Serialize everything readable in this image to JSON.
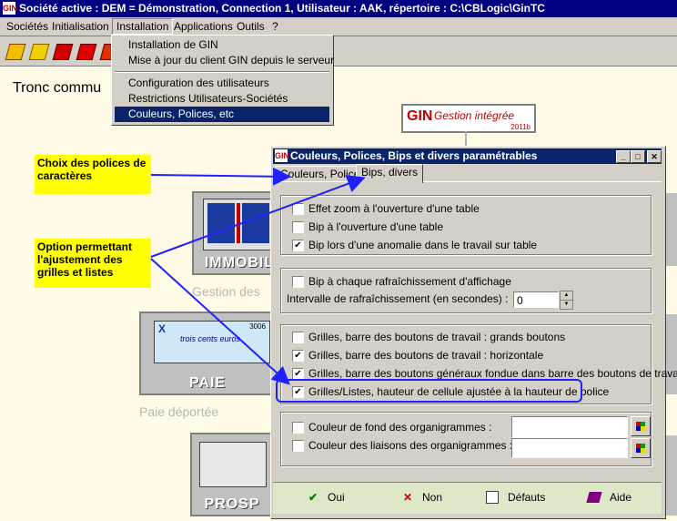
{
  "window": {
    "logo_text": "GIN",
    "title": "Société active : DEM = Démonstration, Connection 1, Utilisateur : AAK, répertoire : C:\\CBLogic\\GinTC"
  },
  "menu": {
    "items": [
      "Sociétés",
      "Initialisation",
      "Installation",
      "Applications",
      "Outils",
      "?"
    ]
  },
  "dropdown": {
    "items": [
      "Installation de GIN",
      "Mise à jour du client GIN depuis le serveur",
      "Configuration des utilisateurs",
      "Restrictions Utilisateurs-Sociétés",
      "Couleurs, Polices, etc"
    ]
  },
  "background": {
    "heading": "Tronc commu",
    "logo_main": "GIN",
    "logo_sub": "Gestion intégrée",
    "logo_year": "2011b",
    "tile_immob": "IMMOBIL",
    "tile_paie": "PAIE",
    "tile_prosp": "PROSP",
    "cheque_number": "3006",
    "cheque_text": "trois cents euros",
    "gray_gestion": "Gestion des",
    "gray_paie": "Paie déportée"
  },
  "notes": {
    "polices": "Choix des polices de caractères",
    "grilles": "Option permettant l'ajustement des grilles et listes"
  },
  "dialog": {
    "title": "Couleurs, Polices, Bips et divers paramétrables",
    "tabs": [
      "Couleurs, Polices",
      "Bips, divers"
    ],
    "group1": [
      {
        "label": "Effet zoom à l'ouverture d'une table",
        "checked": false
      },
      {
        "label": "Bip à l'ouverture d'une table",
        "checked": false
      },
      {
        "label": "Bip lors d'une anomalie dans le travail sur table",
        "checked": true
      }
    ],
    "group2": {
      "checkbox": {
        "label": "Bip à chaque rafraîchissement d'affichage",
        "checked": false
      },
      "interval_label": "Intervalle de rafraîchissement (en secondes) :",
      "interval_value": "0"
    },
    "group3": [
      {
        "label": "Grilles, barre des boutons de travail : grands boutons",
        "checked": false
      },
      {
        "label": "Grilles, barre des boutons de travail : horizontale",
        "checked": true
      },
      {
        "label": "Grilles, barre des boutons généraux fondue dans barre des boutons de travail",
        "checked": true
      },
      {
        "label": "Grilles/Listes, hauteur de cellule ajustée à la hauteur de police",
        "checked": true
      }
    ],
    "group4": [
      {
        "label": "Couleur de fond des organigrammes :",
        "checked": false
      },
      {
        "label": "Couleur des liaisons des organigrammes :",
        "checked": false
      }
    ],
    "buttons": {
      "oui": "Oui",
      "non": "Non",
      "defauts": "Défauts",
      "aide": "Aide"
    },
    "check_mark": "✔",
    "min_glyph": "_",
    "max_glyph": "□",
    "close_glyph": "✕"
  },
  "colors": {
    "titlebar": "#000080",
    "selection": "#0a246a",
    "note_bg": "#ffff00",
    "arrow": "#2020ff"
  }
}
